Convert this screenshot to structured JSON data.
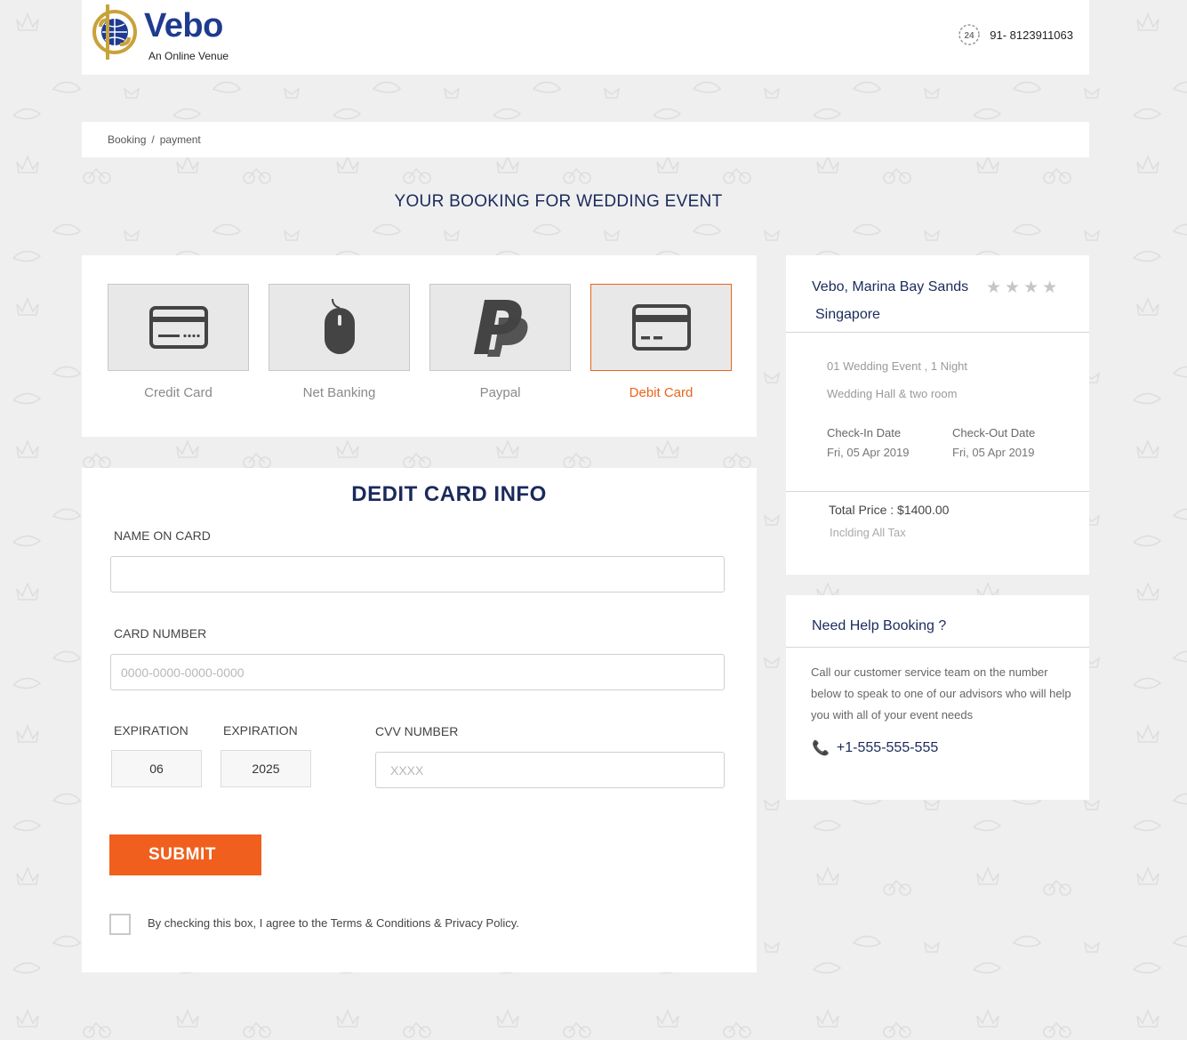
{
  "header": {
    "logo_text": "Vebo",
    "logo_tagline": "An Online Venue",
    "phone": "91- 8123911063"
  },
  "breadcrumb": {
    "items": [
      "Booking",
      "payment"
    ],
    "separator": "/"
  },
  "page_title": "YOUR BOOKING FOR WEDDING EVENT",
  "payment_methods": [
    {
      "label": "Credit Card",
      "icon": "credit-card-icon",
      "active": false
    },
    {
      "label": "Net Banking",
      "icon": "mouse-icon",
      "active": false
    },
    {
      "label": "Paypal",
      "icon": "paypal-icon",
      "active": false
    },
    {
      "label": "Debit Card",
      "icon": "debit-card-icon",
      "active": true
    }
  ],
  "form": {
    "title": "DEDIT CARD INFO",
    "name_label": "NAME ON CARD",
    "name_value": "",
    "card_label": "CARD NUMBER",
    "card_placeholder": "0000-0000-0000-0000",
    "exp_month_label": "EXPIRATION",
    "exp_month_value": "06",
    "exp_year_label": "EXPIRATION",
    "exp_year_value": "2025",
    "cvv_label": "CVV NUMBER",
    "cvv_placeholder": "XXXX",
    "submit_label": "SUBMIT",
    "agree_text": "By checking this box, I agree to the Terms & Conditions & Privacy Policy."
  },
  "summary": {
    "venue_name": "Vebo, Marina Bay Sands",
    "rating": 0,
    "rating_max": 4,
    "city": "Singapore",
    "event_line": "01 Wedding Event , 1 Night",
    "room_line": "Wedding Hall & two room",
    "checkin_label": "Check-In Date",
    "checkin_value": "Fri, 05 Apr 2019",
    "checkout_label": "Check-Out Date",
    "checkout_value": "Fri, 05 Apr 2019",
    "total": "Total Price : $1400.00",
    "tax_note": "Inclding All Tax"
  },
  "help": {
    "title": "Need Help Booking ?",
    "text": "Call our customer service team on the number below to speak to one of our advisors who will help you with all of your event needs",
    "phone": "+1-555-555-555"
  },
  "colors": {
    "accent": "#f05f1e",
    "navy": "#1b2a5c",
    "background": "#efefef"
  }
}
